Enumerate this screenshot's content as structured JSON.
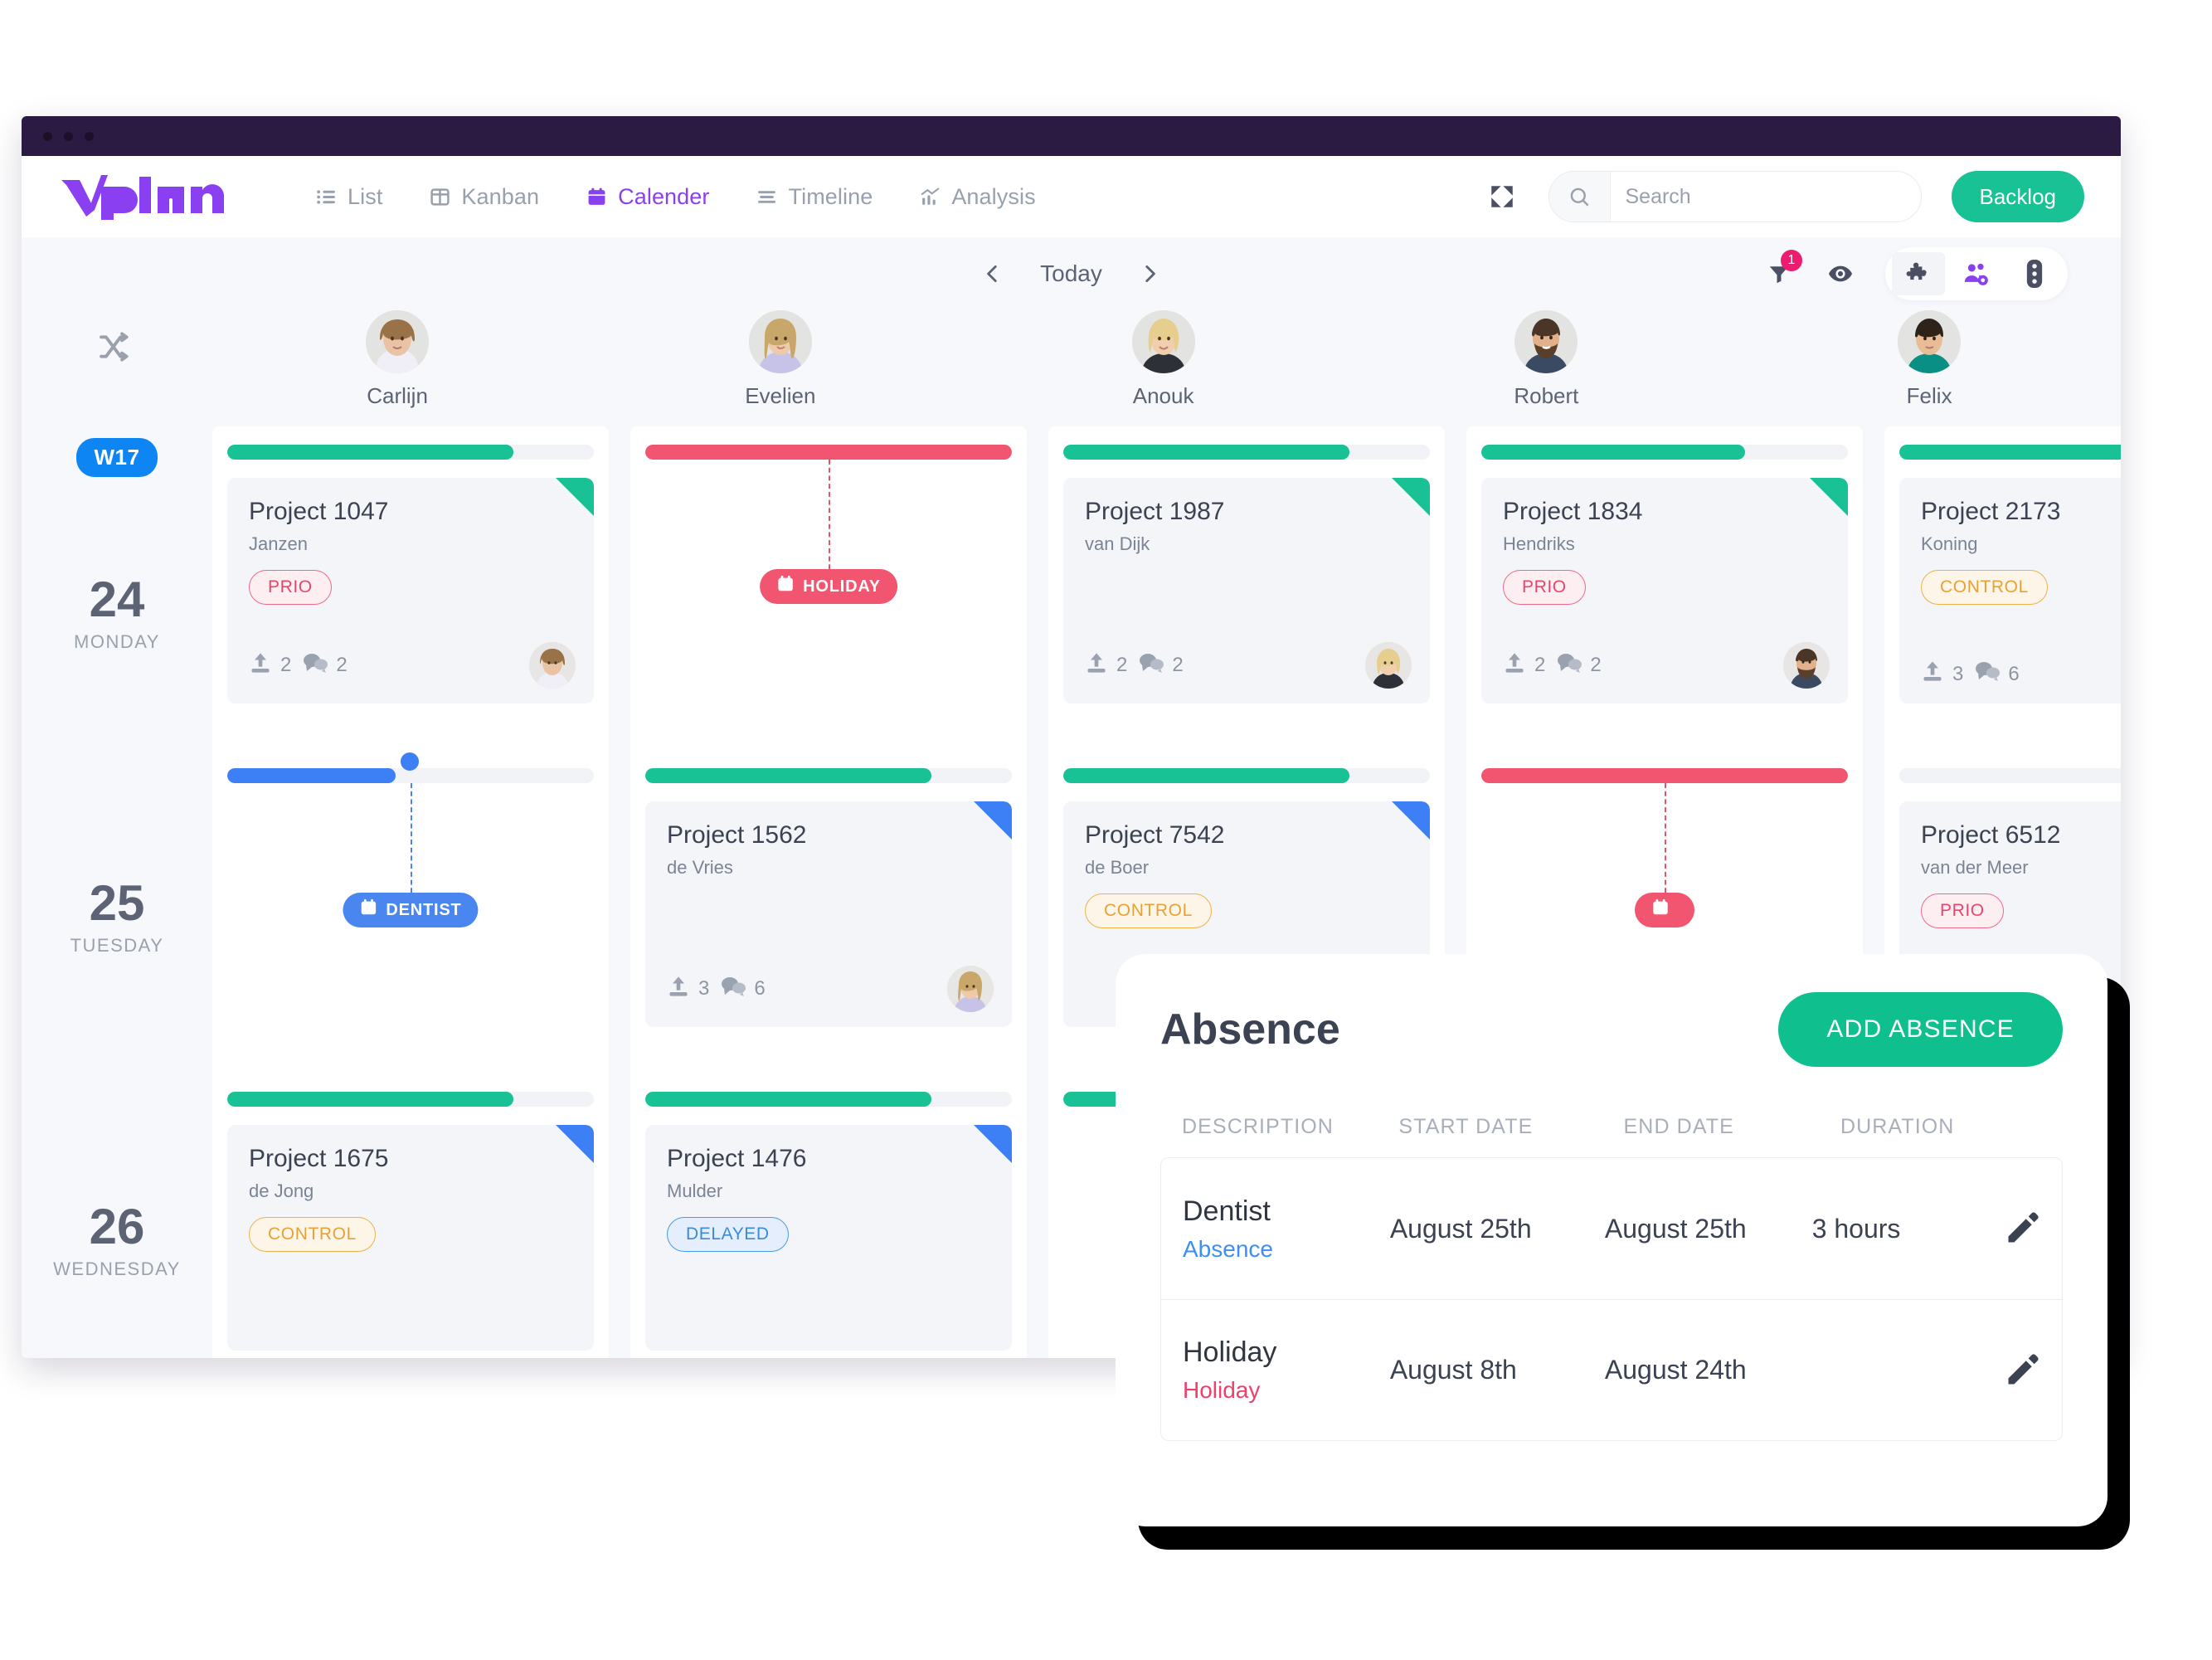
{
  "window": {
    "titlebar_dots": 3
  },
  "topnav": {
    "brand": "vplan",
    "items": [
      {
        "label": "List",
        "icon": "list-icon",
        "active": false
      },
      {
        "label": "Kanban",
        "icon": "kanban-icon",
        "active": false
      },
      {
        "label": "Calender",
        "icon": "calendar-icon",
        "active": true
      },
      {
        "label": "Timeline",
        "icon": "timeline-icon",
        "active": false
      },
      {
        "label": "Analysis",
        "icon": "analysis-icon",
        "active": false
      }
    ],
    "expand_icon": "expand-icon",
    "search": {
      "placeholder": "Search",
      "value": "",
      "icon": "search-icon"
    },
    "backlog_label": "Backlog"
  },
  "toolbar": {
    "prev_label": "‹",
    "today_label": "Today",
    "next_label": "›",
    "filter_icon": "filter-icon",
    "filter_badge": "1",
    "eye_icon": "eye-icon",
    "puzzle_icon": "puzzle-icon",
    "people_settings_icon": "people-settings-icon",
    "more_icon": "more-vertical-icon"
  },
  "shuffle_icon": "shuffle-icon",
  "resources": [
    {
      "name": "Carlijn"
    },
    {
      "name": "Evelien"
    },
    {
      "name": "Anouk"
    },
    {
      "name": "Robert"
    },
    {
      "name": "Felix"
    }
  ],
  "days": [
    {
      "week": "W17",
      "num": "24",
      "name": "MONDAY"
    },
    {
      "week": "",
      "num": "25",
      "name": "TUESDAY"
    },
    {
      "week": "",
      "num": "26",
      "name": "WEDNESDAY"
    }
  ],
  "colors": {
    "brand_purple": "#8a3ff0",
    "green": "#18c295",
    "red": "#f2556f",
    "blue": "#3d7ff5",
    "orange": "#e8a135",
    "week_badge_blue": "#0d85f2",
    "titlebar": "#2b1a42"
  },
  "cells": [
    {
      "day": 0,
      "resource": 0,
      "progress": {
        "percent": 78,
        "color": "green"
      },
      "card": {
        "title": "Project 1047",
        "client": "Janzen",
        "tag": "PRIO",
        "tag_type": "prio",
        "corner": "green",
        "uploads": "2",
        "comments": "2",
        "avatar": "female-1"
      }
    },
    {
      "day": 0,
      "resource": 1,
      "progress": {
        "percent": 100,
        "color": "red"
      },
      "absence": {
        "label": "HOLIDAY",
        "type": "red",
        "icon": "calendar-icon"
      }
    },
    {
      "day": 0,
      "resource": 2,
      "progress": {
        "percent": 78,
        "color": "green"
      },
      "card": {
        "title": "Project 1987",
        "client": "van Dijk",
        "tag": "",
        "tag_type": "",
        "corner": "green",
        "uploads": "2",
        "comments": "2",
        "avatar": "female-2"
      }
    },
    {
      "day": 0,
      "resource": 3,
      "progress": {
        "percent": 72,
        "color": "green"
      },
      "card": {
        "title": "Project 1834",
        "client": "Hendriks",
        "tag": "PRIO",
        "tag_type": "prio",
        "corner": "green",
        "uploads": "2",
        "comments": "2",
        "avatar": "male-1"
      }
    },
    {
      "day": 0,
      "resource": 4,
      "progress": {
        "percent": 100,
        "color": "green"
      },
      "card": {
        "title": "Project 2173",
        "client": "Koning",
        "tag": "CONTROL",
        "tag_type": "control",
        "corner": "none",
        "uploads": "3",
        "comments": "6",
        "avatar": "none"
      }
    },
    {
      "day": 1,
      "resource": 0,
      "progress": {
        "percent": 46,
        "color": "blue",
        "knob": true
      },
      "absence": {
        "label": "DENTIST",
        "type": "blue",
        "icon": "calendar-icon"
      }
    },
    {
      "day": 1,
      "resource": 1,
      "progress": {
        "percent": 78,
        "color": "green"
      },
      "card": {
        "title": "Project 1562",
        "client": "de Vries",
        "tag": "",
        "tag_type": "",
        "corner": "blue",
        "uploads": "3",
        "comments": "6",
        "avatar": "female-3"
      }
    },
    {
      "day": 1,
      "resource": 2,
      "progress": {
        "percent": 78,
        "color": "green"
      },
      "card": {
        "title": "Project 7542",
        "client": "de Boer",
        "tag": "CONTROL",
        "tag_type": "control",
        "corner": "blue",
        "uploads": "",
        "comments": "",
        "avatar": "none"
      }
    },
    {
      "day": 1,
      "resource": 3,
      "progress": {
        "percent": 100,
        "color": "red"
      },
      "absence": {
        "label": "",
        "type": "red",
        "icon": "calendar-icon"
      }
    },
    {
      "day": 1,
      "resource": 4,
      "progress": {
        "percent": 0,
        "color": "none"
      },
      "card": {
        "title": "Project 6512",
        "client": "van der Meer",
        "tag": "PRIO",
        "tag_type": "prio",
        "corner": "none",
        "uploads": "",
        "comments": "",
        "avatar": "none"
      }
    },
    {
      "day": 2,
      "resource": 0,
      "progress": {
        "percent": 78,
        "color": "green"
      },
      "card": {
        "title": "Project 1675",
        "client": "de Jong",
        "tag": "CONTROL",
        "tag_type": "control",
        "corner": "blue",
        "uploads": "",
        "comments": "",
        "avatar": "none"
      }
    },
    {
      "day": 2,
      "resource": 1,
      "progress": {
        "percent": 78,
        "color": "green"
      },
      "card": {
        "title": "Project 1476",
        "client": "Mulder",
        "tag": "DELAYED",
        "tag_type": "delayed",
        "corner": "blue",
        "uploads": "",
        "comments": "",
        "avatar": "none"
      }
    },
    {
      "day": 2,
      "resource": 2,
      "progress": {
        "percent": 78,
        "color": "green"
      },
      "card": null
    }
  ],
  "absence_modal": {
    "title": "Absence",
    "add_button": "ADD ABSENCE",
    "columns": [
      "DESCRIPTION",
      "START DATE",
      "END DATE",
      "DURATION"
    ],
    "rows": [
      {
        "description": "Dentist",
        "type": "Absence",
        "type_color": "absence",
        "start_date": "August 25th",
        "end_date": "August 25th",
        "duration": "3 hours",
        "edit_icon": "pencil-icon"
      },
      {
        "description": "Holiday",
        "type": "Holiday",
        "type_color": "holiday",
        "start_date": "August 8th",
        "end_date": "August 24th",
        "duration": "",
        "edit_icon": "pencil-icon"
      }
    ]
  }
}
